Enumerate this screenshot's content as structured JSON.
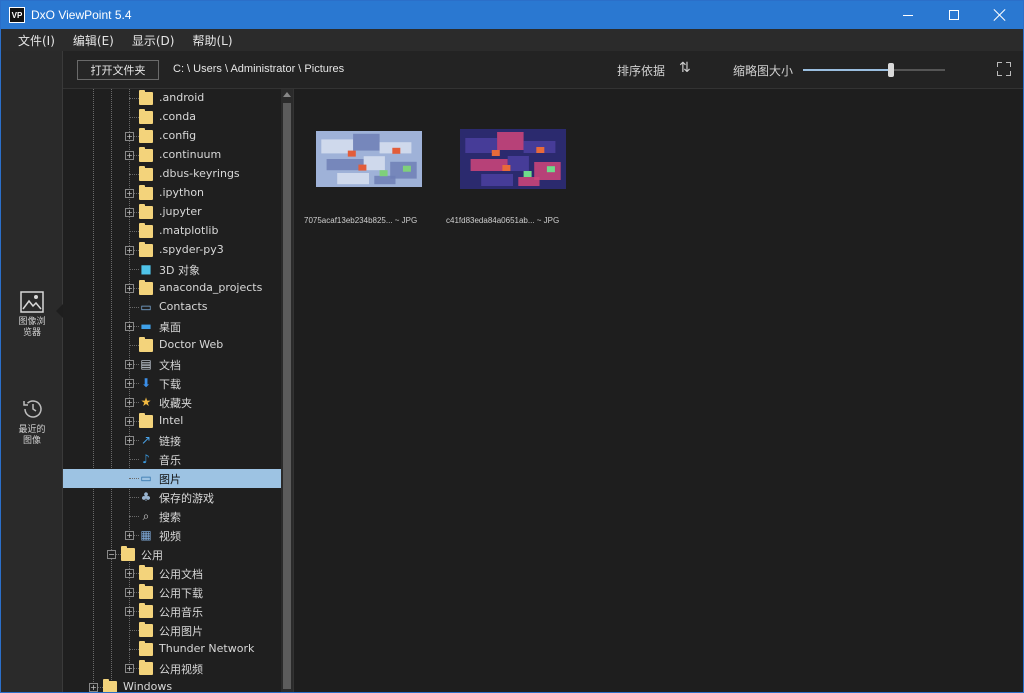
{
  "window": {
    "logo_text": "VP",
    "title": "DxO ViewPoint 5.4"
  },
  "menu": [
    "文件(I)",
    "编辑(E)",
    "显示(D)",
    "帮助(L)"
  ],
  "rail": {
    "browser_label": "图像浏览器",
    "recent_label": "最近的图像"
  },
  "toolbar": {
    "open_folder": "打开文件夹",
    "path": "C: \\ Users \\ Administrator \\ Pictures",
    "sort_label": "排序依据",
    "thumb_size_label": "缩略图大小",
    "thumb_size_level": 0.62
  },
  "tree": [
    {
      "label": ".android",
      "icon": "folder",
      "exp": false
    },
    {
      "label": ".conda",
      "icon": "folder",
      "exp": false
    },
    {
      "label": ".config",
      "icon": "folder",
      "exp": true
    },
    {
      "label": ".continuum",
      "icon": "folder",
      "exp": true
    },
    {
      "label": ".dbus-keyrings",
      "icon": "folder",
      "exp": false
    },
    {
      "label": ".ipython",
      "icon": "folder",
      "exp": true
    },
    {
      "label": ".jupyter",
      "icon": "folder",
      "exp": true
    },
    {
      "label": ".matplotlib",
      "icon": "folder",
      "exp": false
    },
    {
      "label": ".spyder-py3",
      "icon": "folder",
      "exp": true
    },
    {
      "label": "3D 对象",
      "icon": "cube",
      "exp": false
    },
    {
      "label": "anaconda_projects",
      "icon": "folder",
      "exp": true
    },
    {
      "label": "Contacts",
      "icon": "contacts",
      "exp": false
    },
    {
      "label": "桌面",
      "icon": "desktop",
      "exp": true
    },
    {
      "label": "Doctor Web",
      "icon": "folder",
      "exp": false
    },
    {
      "label": "文档",
      "icon": "document",
      "exp": true
    },
    {
      "label": "下载",
      "icon": "download",
      "exp": true
    },
    {
      "label": "收藏夹",
      "icon": "star",
      "exp": true
    },
    {
      "label": "Intel",
      "icon": "folder",
      "exp": true
    },
    {
      "label": "链接",
      "icon": "link",
      "exp": true
    },
    {
      "label": "音乐",
      "icon": "music",
      "exp": false
    },
    {
      "label": "图片",
      "icon": "pictures",
      "exp": false,
      "selected": true
    },
    {
      "label": "保存的游戏",
      "icon": "games",
      "exp": false
    },
    {
      "label": "搜索",
      "icon": "search",
      "exp": false
    },
    {
      "label": "视频",
      "icon": "video",
      "exp": true
    },
    {
      "label": "公用",
      "icon": "folder",
      "exp": "open",
      "level": 1
    },
    {
      "label": "公用文档",
      "icon": "folder",
      "exp": true
    },
    {
      "label": "公用下载",
      "icon": "folder",
      "exp": true
    },
    {
      "label": "公用音乐",
      "icon": "folder",
      "exp": true
    },
    {
      "label": "公用图片",
      "icon": "folder",
      "exp": false
    },
    {
      "label": "Thunder Network",
      "icon": "folder",
      "exp": false
    },
    {
      "label": "公用视频",
      "icon": "folder",
      "exp": true
    },
    {
      "label": "Windows",
      "icon": "folder",
      "exp": true,
      "level": 0
    }
  ],
  "thumbnails": [
    {
      "name": "7075acaf13eb234b825... ~ JPG"
    },
    {
      "name": "c41fd83eda84a0651ab... ~ JPG"
    }
  ]
}
